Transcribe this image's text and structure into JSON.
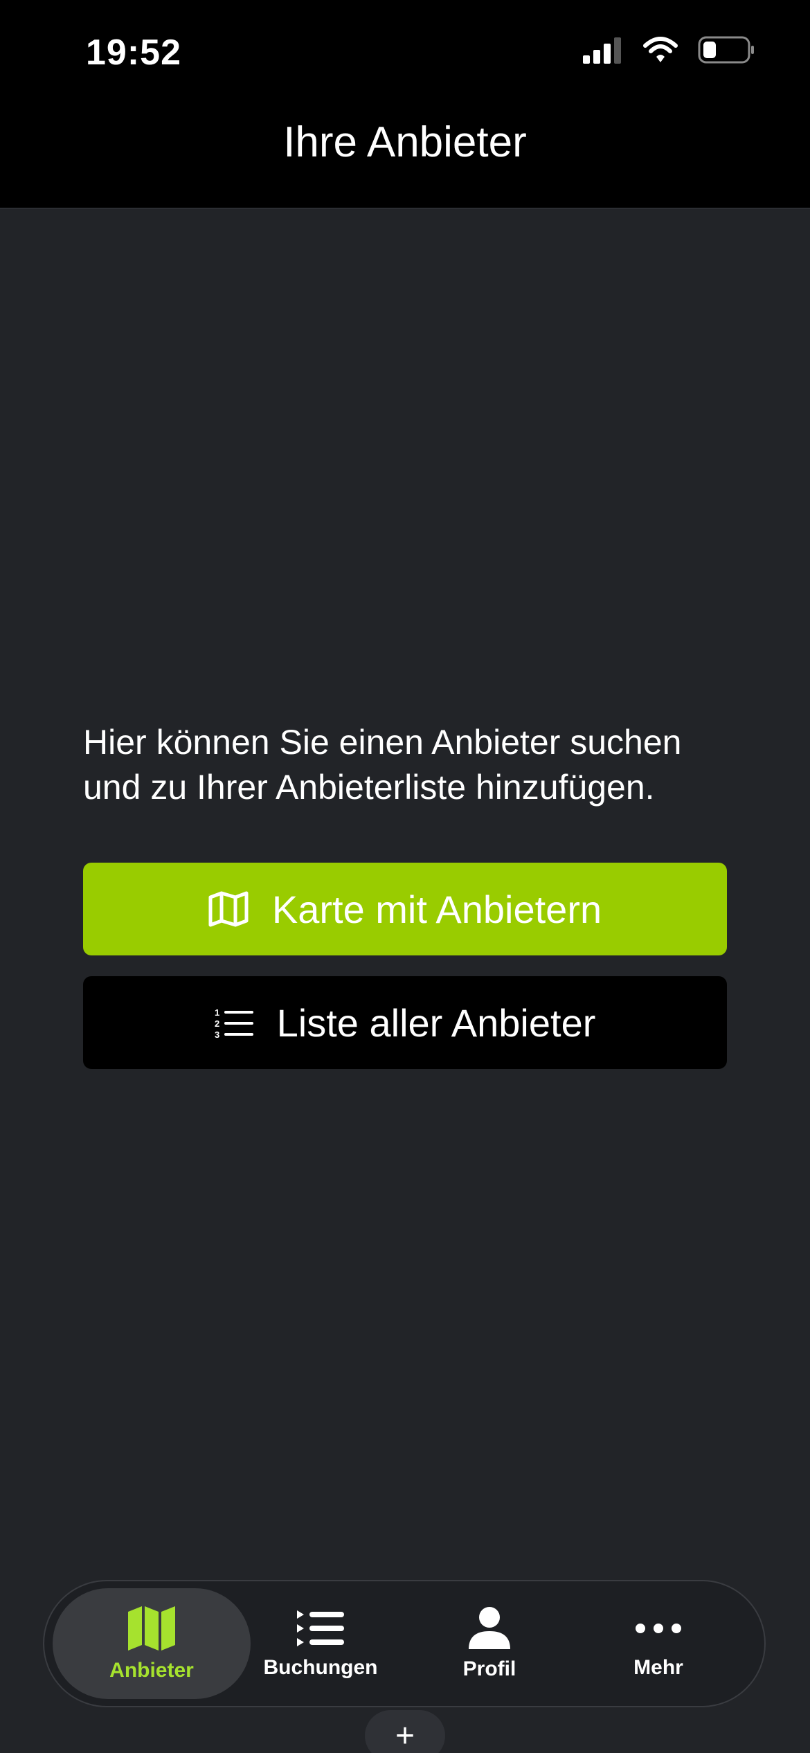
{
  "status": {
    "time": "19:52"
  },
  "nav": {
    "title": "Ihre Anbieter"
  },
  "main": {
    "intro": "Hier können Sie einen Anbieter suchen und zu Ihrer Anbieterliste hinzufügen.",
    "map_button": {
      "label": "Karte mit Anbietern",
      "icon": "map-icon"
    },
    "list_button": {
      "label": "Liste aller Anbieter",
      "icon": "numbered-list-icon"
    }
  },
  "fab": {
    "label": "+"
  },
  "tabs": [
    {
      "label": "Anbieter",
      "icon": "map-icon",
      "active": true
    },
    {
      "label": "Buchungen",
      "icon": "list-icon",
      "active": false
    },
    {
      "label": "Profil",
      "icon": "person-icon",
      "active": false
    },
    {
      "label": "Mehr",
      "icon": "more-icon",
      "active": false
    }
  ],
  "colors": {
    "accent": "#99cc00",
    "active_tab": "#a6e22e",
    "background": "#222428",
    "bar": "#000000"
  }
}
